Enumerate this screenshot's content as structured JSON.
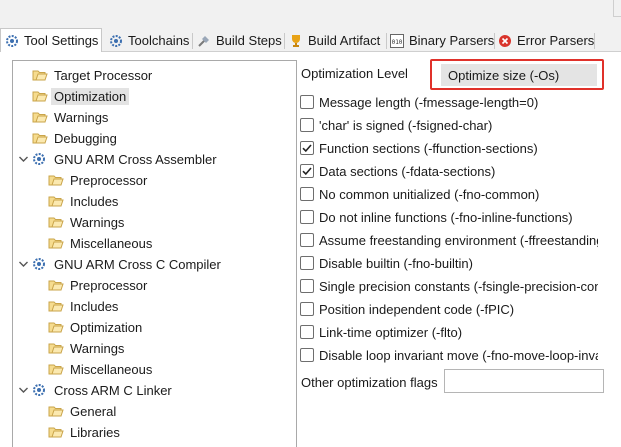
{
  "tabs": [
    {
      "label": "Tool Settings",
      "icon": "tool-settings-icon",
      "active": true
    },
    {
      "label": "Toolchains",
      "icon": "toolchains-icon",
      "active": false
    },
    {
      "label": "Build Steps",
      "icon": "build-steps-icon",
      "active": false
    },
    {
      "label": "Build Artifact",
      "icon": "build-artifact-icon",
      "active": false
    },
    {
      "label": "Binary Parsers",
      "icon": "binary-parsers-icon",
      "active": false
    },
    {
      "label": "Error Parsers",
      "icon": "error-parsers-icon",
      "active": false
    }
  ],
  "tree": [
    {
      "label": "Target Processor",
      "level": 1,
      "type": "folder"
    },
    {
      "label": "Optimization",
      "level": 1,
      "type": "folder",
      "selected": true
    },
    {
      "label": "Warnings",
      "level": 1,
      "type": "folder"
    },
    {
      "label": "Debugging",
      "level": 1,
      "type": "folder"
    },
    {
      "label": "GNU ARM Cross Assembler",
      "level": 0,
      "type": "tool",
      "expanded": true
    },
    {
      "label": "Preprocessor",
      "level": 2,
      "type": "folder"
    },
    {
      "label": "Includes",
      "level": 2,
      "type": "folder"
    },
    {
      "label": "Warnings",
      "level": 2,
      "type": "folder"
    },
    {
      "label": "Miscellaneous",
      "level": 2,
      "type": "folder"
    },
    {
      "label": "GNU ARM Cross C Compiler",
      "level": 0,
      "type": "tool",
      "expanded": true
    },
    {
      "label": "Preprocessor",
      "level": 2,
      "type": "folder"
    },
    {
      "label": "Includes",
      "level": 2,
      "type": "folder"
    },
    {
      "label": "Optimization",
      "level": 2,
      "type": "folder"
    },
    {
      "label": "Warnings",
      "level": 2,
      "type": "folder"
    },
    {
      "label": "Miscellaneous",
      "level": 2,
      "type": "folder"
    },
    {
      "label": "Cross ARM C Linker",
      "level": 0,
      "type": "tool",
      "expanded": true
    },
    {
      "label": "General",
      "level": 2,
      "type": "folder"
    },
    {
      "label": "Libraries",
      "level": 2,
      "type": "folder"
    }
  ],
  "optimization": {
    "label": "Optimization Level",
    "value": "Optimize size (-Os)",
    "highlight_color": "#e0312a"
  },
  "options": [
    {
      "label": "Message length (-fmessage-length=0)",
      "checked": false
    },
    {
      "label": "'char' is signed (-fsigned-char)",
      "checked": false
    },
    {
      "label": "Function sections (-ffunction-sections)",
      "checked": true
    },
    {
      "label": "Data sections (-fdata-sections)",
      "checked": true
    },
    {
      "label": "No common unitialized (-fno-common)",
      "checked": false
    },
    {
      "label": "Do not inline functions (-fno-inline-functions)",
      "checked": false
    },
    {
      "label": "Assume freestanding environment (-ffreestanding)",
      "checked": false
    },
    {
      "label": "Disable builtin (-fno-builtin)",
      "checked": false
    },
    {
      "label": "Single precision constants (-fsingle-precision-constant)",
      "checked": false
    },
    {
      "label": "Position independent code (-fPIC)",
      "checked": false
    },
    {
      "label": "Link-time optimizer (-flto)",
      "checked": false
    },
    {
      "label": "Disable loop invariant move (-fno-move-loop-invariants)",
      "checked": false
    }
  ],
  "other_flags": {
    "label": "Other optimization flags",
    "value": ""
  }
}
